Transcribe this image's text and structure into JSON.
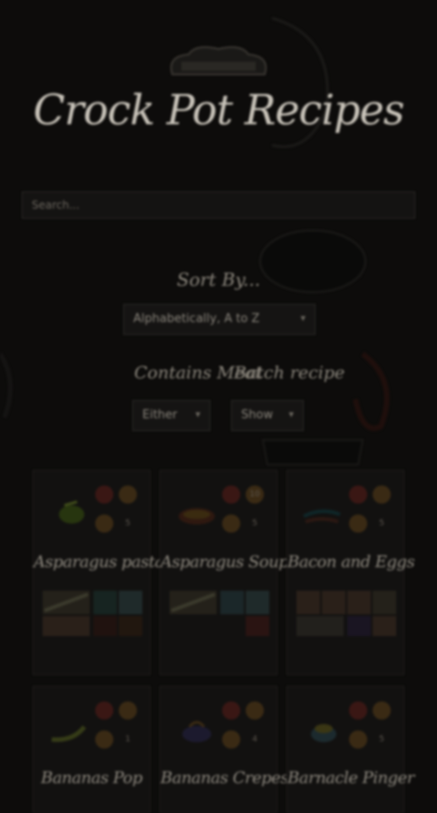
{
  "header": {
    "title": "Crock Pot Recipes",
    "tagline": ""
  },
  "search": {
    "placeholder": "Search..."
  },
  "sort": {
    "label": "Sort By...",
    "selected": "Alphabetically, A to Z"
  },
  "filters": {
    "meat_label": "Contains Meat",
    "meat_selected": "Either",
    "batch_label": "Batch recipe",
    "batch_selected": "Show"
  },
  "recipes": [
    {
      "name": "Asparagus pasta",
      "stat1": "",
      "stat2": "",
      "stat3": "",
      "stat4": "5"
    },
    {
      "name": "Asparagus Soup",
      "stat1": "",
      "stat2": "10",
      "stat3": "",
      "stat4": "5"
    },
    {
      "name": "Bacon and Eggs",
      "stat1": "",
      "stat2": "",
      "stat3": "",
      "stat4": "5"
    },
    {
      "name": "Bananas Pop",
      "stat1": "",
      "stat2": "",
      "stat3": "",
      "stat4": "1"
    },
    {
      "name": "Bananas Crepes",
      "stat1": "",
      "stat2": "",
      "stat3": "",
      "stat4": "4"
    },
    {
      "name": "Barnacle Pinger",
      "stat1": "",
      "stat2": "",
      "stat3": "",
      "stat4": "5"
    }
  ],
  "colors": {
    "background": "#0d0c0b",
    "text": "#9a958c",
    "badge_red": "#3a1714",
    "badge_brown": "#3a2a14"
  }
}
